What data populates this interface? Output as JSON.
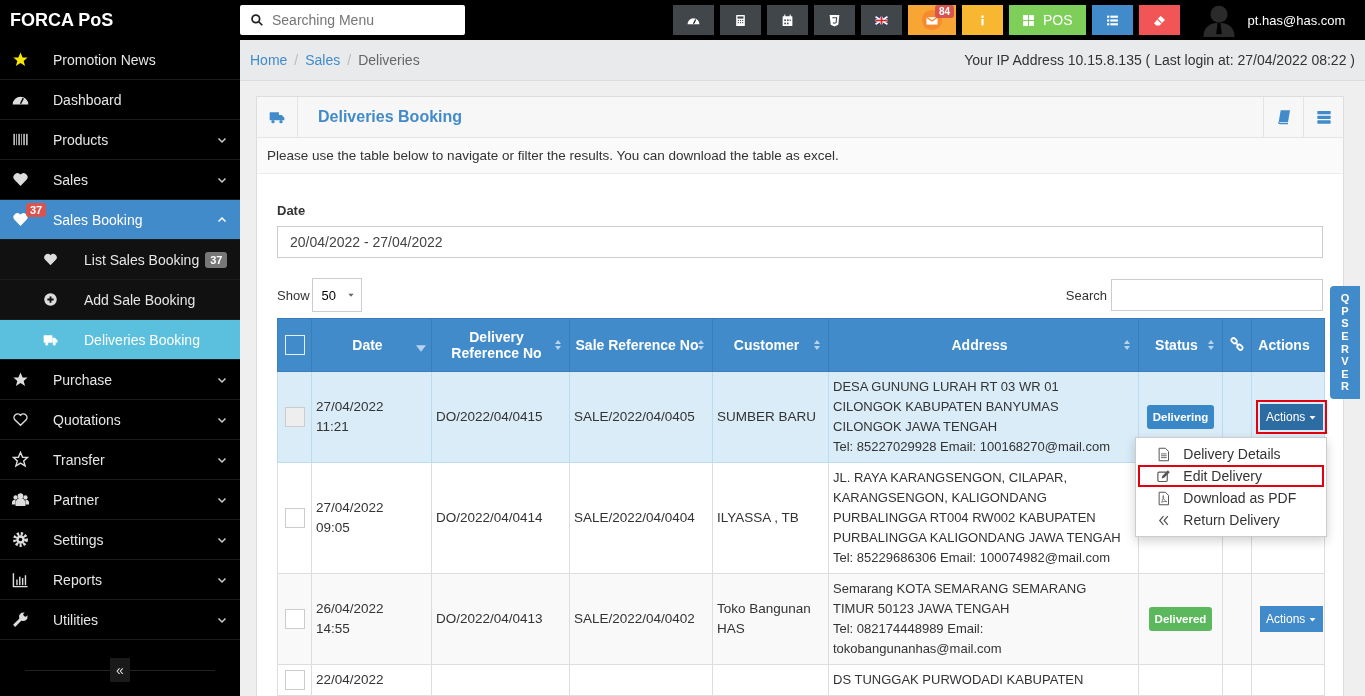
{
  "brand": "FORCA PoS",
  "search": {
    "placeholder": "Searching Menu"
  },
  "toolbar": [
    {
      "color": "#41464b"
    },
    {
      "color": "#41464b"
    },
    {
      "color": "#41464b"
    },
    {
      "color": "#41464b"
    },
    {
      "color": "#41464b"
    },
    {
      "color": "#f7a535",
      "badge": "84"
    },
    {
      "color": "#f7b731"
    },
    {
      "color": "#7dcf59",
      "label": "POS"
    },
    {
      "color": "#428bca"
    },
    {
      "color": "#f25555"
    }
  ],
  "user": {
    "email": "pt.has@has.com"
  },
  "sidebar": {
    "items": [
      {
        "label": "Promotion News",
        "kind": "link",
        "selected": false
      },
      {
        "label": "Dashboard",
        "kind": "link",
        "selected": false
      },
      {
        "label": "Products",
        "kind": "menu",
        "expanded": false,
        "selected": false
      },
      {
        "label": "Sales",
        "kind": "menu",
        "expanded": false,
        "selected": false
      },
      {
        "label": "Sales Booking",
        "kind": "menu",
        "expanded": true,
        "selected": true,
        "badge": "37",
        "children": [
          {
            "label": "List Sales Booking",
            "badge": "37",
            "selected": false
          },
          {
            "label": "Add Sale Booking",
            "selected": false
          },
          {
            "label": "Deliveries Booking",
            "selected": true
          }
        ]
      },
      {
        "label": "Purchase",
        "kind": "menu",
        "expanded": false,
        "selected": false
      },
      {
        "label": "Quotations",
        "kind": "menu",
        "expanded": false,
        "selected": false
      },
      {
        "label": "Transfer",
        "kind": "menu",
        "expanded": false,
        "selected": false
      },
      {
        "label": "Partner",
        "kind": "menu",
        "expanded": false,
        "selected": false
      },
      {
        "label": "Settings",
        "kind": "menu",
        "expanded": false,
        "selected": false
      },
      {
        "label": "Reports",
        "kind": "menu",
        "expanded": false,
        "selected": false
      },
      {
        "label": "Utilities",
        "kind": "menu",
        "expanded": false,
        "selected": false
      }
    ],
    "collapse": "«"
  },
  "breadcrumb": [
    {
      "label": "Home",
      "link": true
    },
    {
      "separator": "/",
      "label": "Sales",
      "link": true
    },
    {
      "separator": "/",
      "label": "Deliveries",
      "link": false
    }
  ],
  "login_info": "Your IP Address 10.15.8.135 ( Last login at: 27/04/2022 08:22 )",
  "panel": {
    "title": "Deliveries Booking",
    "intro": "Please use the table below to navigate or filter the results. You can download the table as excel.",
    "date_filter": {
      "label": "Date",
      "value": "20/04/2022 - 27/04/2022"
    },
    "show": {
      "label": "Show",
      "value": "50"
    },
    "search": {
      "label": "Search"
    }
  },
  "table": {
    "columns": [
      {
        "kind": "checkbox",
        "checked": false
      },
      {
        "kind": "text",
        "label": "Date",
        "sortable": true,
        "sorted": true
      },
      {
        "kind": "text",
        "label": "Delivery Reference No",
        "sortable": true,
        "sorted": false
      },
      {
        "kind": "text",
        "label": "Sale Reference No",
        "sortable": true,
        "sorted": false
      },
      {
        "kind": "text",
        "label": "Customer",
        "sortable": true,
        "sorted": false
      },
      {
        "kind": "text",
        "label": "Address",
        "sortable": true,
        "sorted": false
      },
      {
        "kind": "text",
        "label": "Status",
        "sortable": true,
        "sorted": false
      },
      {
        "kind": "icon"
      },
      {
        "kind": "text",
        "label": "Actions",
        "sortable": false
      }
    ],
    "rows": [
      {
        "selected": true,
        "checked": false,
        "date": "27/04/2022",
        "time": "11:21",
        "delivery_ref": "DO/2022/04/0415",
        "sale_ref": "SALE/2022/04/0405",
        "customer": "SUMBER BARU",
        "address": [
          "DESA GUNUNG LURAH RT 03 WR 01",
          "CILONGOK KABUPATEN BANYUMAS",
          "CILONGOK JAWA TENGAH",
          "Tel: 85227029928 Email: 100168270@mail.com"
        ],
        "status": {
          "label": "Delivering",
          "color": "#3a87c8"
        },
        "action": {
          "label": "Actions",
          "highlighted": true,
          "menu": [
            {
              "label": "Delivery Details",
              "highlighted": false
            },
            {
              "label": "Edit Delivery",
              "highlighted": true
            },
            {
              "label": "Download as PDF",
              "highlighted": false
            },
            {
              "label": "Return Delivery",
              "highlighted": false
            }
          ]
        }
      },
      {
        "selected": false,
        "checked": false,
        "date": "27/04/2022",
        "time": "09:05",
        "delivery_ref": "DO/2022/04/0414",
        "sale_ref": "SALE/2022/04/0404",
        "customer": "ILYASSA , TB",
        "address": [
          "JL. RAYA KARANGSENGON, CILAPAR,",
          "KARANGSENGON, KALIGONDANG",
          "PURBALINGGA RT004 RW002 KABUPATEN",
          "PURBALINGGA KALIGONDANG JAWA TENGAH",
          "Tel: 85229686306 Email: 100074982@mail.com"
        ]
      },
      {
        "selected": false,
        "checked": false,
        "date": "26/04/2022",
        "time": "14:55",
        "delivery_ref": "DO/2022/04/0413",
        "sale_ref": "SALE/2022/04/0402",
        "customer": "Toko Bangunan HAS",
        "address": [
          "Semarang KOTA SEMARANG SEMARANG",
          "TIMUR 50123 JAWA TENGAH",
          "Tel: 082174448989 Email:",
          "tokobangunanhas@mail.com"
        ],
        "status": {
          "label": "Delivered",
          "color": "#5cb85c"
        },
        "action": {
          "label": "Actions",
          "highlighted": false
        }
      },
      {
        "selected": false,
        "checked": false,
        "date": "22/04/2022",
        "address": [
          "DS TUNGGAK PURWODADI KABUPATEN"
        ]
      }
    ]
  },
  "side_tab": {
    "label": "QP SERVER"
  }
}
